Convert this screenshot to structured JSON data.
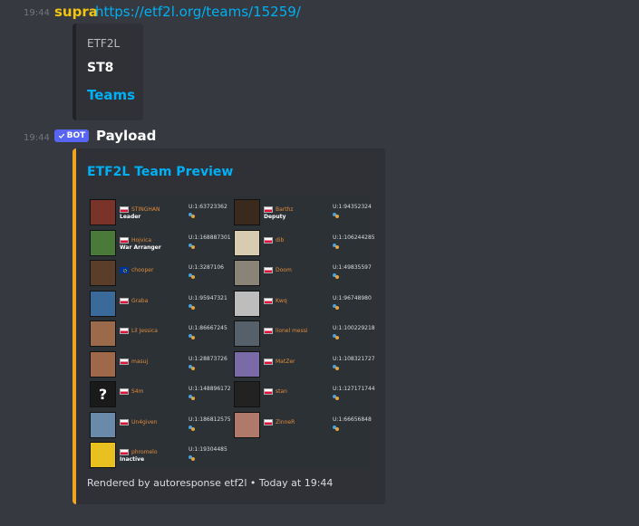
{
  "message1": {
    "time": "19:44",
    "author": "supra",
    "link": "https://etf2l.org/teams/15259/"
  },
  "embed1": {
    "provider": "ETF2L",
    "author": "ST8",
    "title": "Teams"
  },
  "message2": {
    "time": "19:44",
    "badge": "BOT",
    "author": "Payload"
  },
  "embed2": {
    "title": "ETF2L Team Preview",
    "footer": "Rendered by autoresponse etf2l • Today at 19:44",
    "accent": "#f0a51e"
  },
  "players": [
    {
      "name": "STINGHAN",
      "role": "Leader",
      "steam": "U:1:63723362",
      "flag": "pl",
      "avatar": "#7a3328"
    },
    {
      "name": "Barthz",
      "role": "Deputy",
      "steam": "U:1:94352324",
      "flag": "pl",
      "avatar": "#3a2a1e"
    },
    {
      "name": "Hojvica",
      "role": "War Arranger",
      "steam": "U:1:168887301",
      "flag": "pl",
      "avatar": "#4a7a3a"
    },
    {
      "name": "dib",
      "role": "",
      "steam": "U:1:106244285",
      "flag": "pl",
      "avatar": "#d8ccb0"
    },
    {
      "name": "chooper",
      "role": "",
      "steam": "U:1:3287106",
      "flag": "eu",
      "avatar": "#5a3e2a"
    },
    {
      "name": "Doom",
      "role": "",
      "steam": "U:1:49835597",
      "flag": "pl",
      "avatar": "#8a8378"
    },
    {
      "name": "Graba",
      "role": "",
      "steam": "U:1:95947321",
      "flag": "pl",
      "avatar": "#3a6a9a"
    },
    {
      "name": "Kwq",
      "role": "",
      "steam": "U:1:96748980",
      "flag": "pl",
      "avatar": "#bdbdbd"
    },
    {
      "name": "Lil Jessica",
      "role": "",
      "steam": "U:1:86667245",
      "flag": "pl",
      "avatar": "#9a6a4a"
    },
    {
      "name": "lionel messi",
      "role": "",
      "steam": "U:1:100229218",
      "flag": "pl",
      "avatar": "#55606a"
    },
    {
      "name": "masuj",
      "role": "",
      "steam": "U:1:28873726",
      "flag": "pl",
      "avatar": "#a0684a"
    },
    {
      "name": "MatZer",
      "role": "",
      "steam": "U:1:108321727",
      "flag": "pl",
      "avatar": "#7a6aa8"
    },
    {
      "name": "S4m",
      "role": "",
      "steam": "U:1:148896172",
      "flag": "pl",
      "avatar": "#1a1a1a",
      "glyph": "?"
    },
    {
      "name": "stan",
      "role": "",
      "steam": "U:1:127171744",
      "flag": "pl",
      "avatar": "#222222"
    },
    {
      "name": "Un4given",
      "role": "",
      "steam": "U:1:186812575",
      "flag": "pl",
      "avatar": "#6a8aaa"
    },
    {
      "name": "ZinneR",
      "role": "",
      "steam": "U:1:66656848",
      "flag": "pl",
      "avatar": "#b07a6a"
    },
    {
      "name": "phromelo",
      "role": "Inactive",
      "steam": "U:1:19304485",
      "flag": "pl",
      "avatar": "#e8c020"
    }
  ]
}
